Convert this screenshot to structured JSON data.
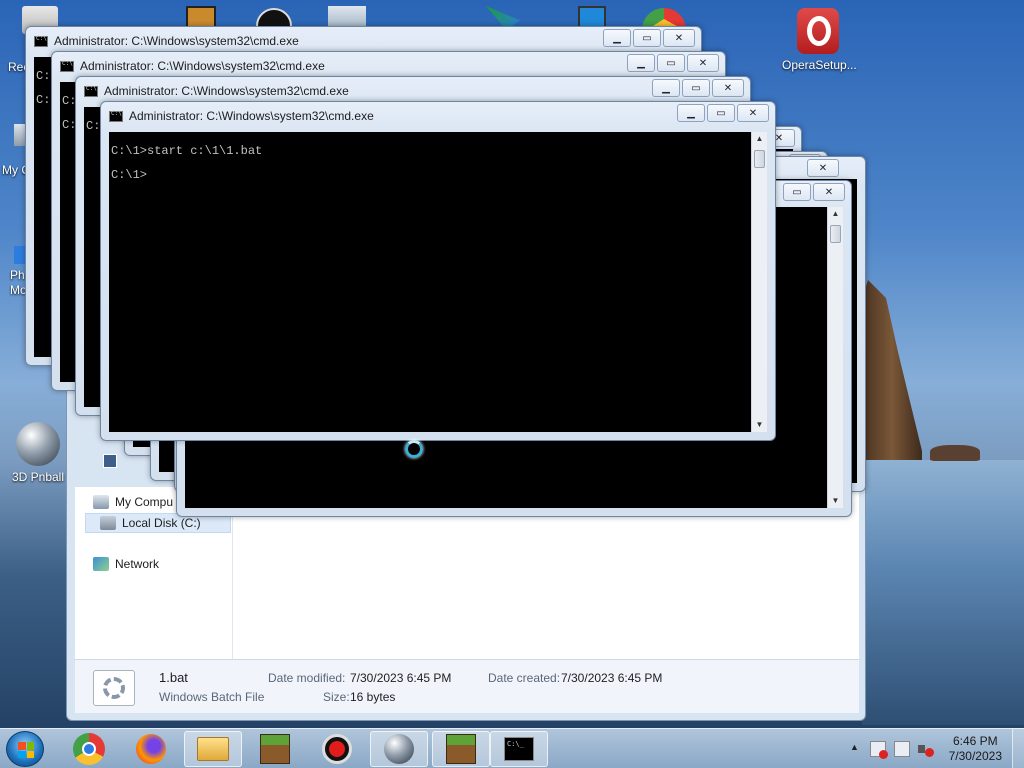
{
  "desktop": {
    "icons": [
      {
        "label": "OperaSetup..."
      },
      {
        "label": "3D Pnball"
      }
    ],
    "fragments": [
      "Rec",
      "My C",
      "Ph",
      "Mo"
    ]
  },
  "explorer": {
    "nav": [
      "My Compu",
      "Local Disk (C:)",
      "Network"
    ],
    "details": {
      "file_name": "1.bat",
      "file_type": "Windows Batch File",
      "date_modified_label": "Date modified:",
      "date_modified": "7/30/2023 6:45 PM",
      "date_created_label": "Date created:",
      "date_created": "7/30/2023 6:45 PM",
      "size_label": "Size:",
      "size": "16 bytes"
    }
  },
  "cmd": {
    "title": "Administrator: C:\\Windows\\system32\\cmd.exe",
    "bg_fragments": [
      "C:",
      "C:"
    ],
    "lines": [
      "C:\\1>start c:\\1\\1.bat",
      "C:\\1>"
    ]
  },
  "taskbar": {
    "apps": [
      "chrome-icon",
      "firefox-icon",
      "file-explorer-icon",
      "minecraft-icon",
      "recorder-icon",
      "pinball-icon",
      "minecraft-icon",
      "cmd-icon"
    ],
    "clock_time": "6:46 PM",
    "clock_date": "7/30/2023"
  },
  "colors": {
    "console_bg": "#000000",
    "console_text": "#c0c0c0",
    "accent": "#1c6fb9"
  }
}
